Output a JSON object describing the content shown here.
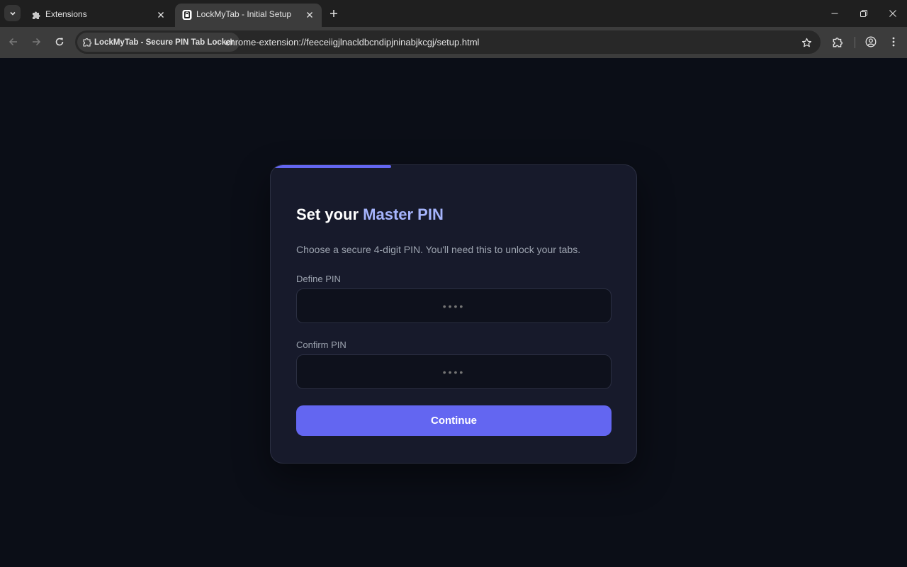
{
  "browser": {
    "tabs": [
      {
        "title": "Extensions",
        "icon": "puzzle-icon",
        "active": false
      },
      {
        "title": "LockMyTab - Initial Setup",
        "icon": "lock-icon",
        "active": true
      }
    ],
    "site_chip": "LockMyTab - Secure PIN Tab Locker",
    "url": "chrome-extension://feeceiigjlnacldbcndipjninabjkcgj/setup.html"
  },
  "setup": {
    "progress": 0.33,
    "heading_prefix": "Set your ",
    "heading_accent": "Master PIN",
    "description": "Choose a secure 4-digit PIN. You'll need this to unlock your tabs.",
    "define_label": "Define PIN",
    "define_placeholder": "••••",
    "confirm_label": "Confirm PIN",
    "confirm_placeholder": "••••",
    "continue_label": "Continue"
  },
  "colors": {
    "page_bg": "#0b0e17",
    "card_bg": "#171a2b",
    "accent": "#6366f1",
    "heading_accent": "#a5b4fc"
  }
}
